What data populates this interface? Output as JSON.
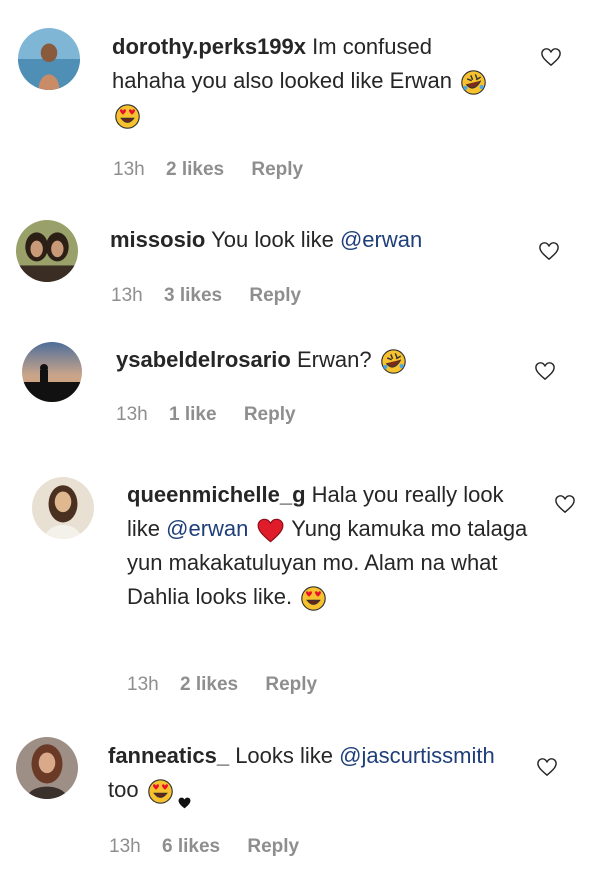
{
  "comments": [
    {
      "username": "dorothy.perks199x",
      "text_1": "Im confused hahaha you also looked like Erwan",
      "time": "13h",
      "likes": "2 likes",
      "reply": "Reply"
    },
    {
      "username": "missosio",
      "text_1": "You look like",
      "mention": "@erwan",
      "time": "13h",
      "likes": "3 likes",
      "reply": "Reply"
    },
    {
      "username": "ysabeldelrosario",
      "text_1": "Erwan?",
      "time": "13h",
      "likes": "1 like",
      "reply": "Reply"
    },
    {
      "username": "queenmichelle_g",
      "text_1": "Hala you really look like",
      "mention": "@erwan",
      "text_2": "Yung kamuka mo talaga yun makakatuluyan mo. Alam na what Dahlia looks like.",
      "time": "13h",
      "likes": "2 likes",
      "reply": "Reply"
    },
    {
      "username": "fanneatics_",
      "text_1": "Looks like",
      "mention": "@jascurtissmith",
      "text_2": "too",
      "time": "13h",
      "likes": "6 likes",
      "reply": "Reply"
    }
  ],
  "icons": {
    "like": "heart-outline-icon",
    "laugh": "rolling-on-floor-laughing-emoji",
    "love": "heart-eyes-emoji",
    "red_heart": "red-heart-emoji",
    "black_heart": "black-heart-emoji"
  },
  "colors": {
    "text": "#262626",
    "meta": "#8e8e8e",
    "mention": "#1f3f7a"
  }
}
